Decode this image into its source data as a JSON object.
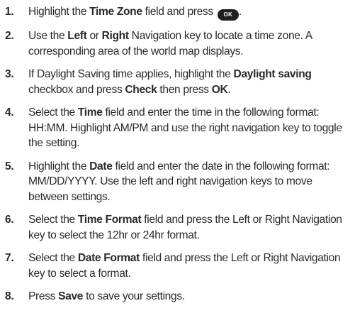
{
  "steps": [
    {
      "number": "1.",
      "parts": [
        {
          "t": "Highlight the "
        },
        {
          "t": "Time Zone",
          "b": true
        },
        {
          "t": " field and press "
        },
        {
          "key": "OK"
        },
        {
          "t": "."
        }
      ]
    },
    {
      "number": "2.",
      "parts": [
        {
          "t": "Use the "
        },
        {
          "t": "Left",
          "b": true
        },
        {
          "t": " or "
        },
        {
          "t": "Right",
          "b": true
        },
        {
          "t": " Navigation key to locate a time zone. A corresponding area of the world map displays."
        }
      ]
    },
    {
      "number": "3.",
      "parts": [
        {
          "t": "If Daylight Saving time applies, highlight the "
        },
        {
          "t": "Daylight saving",
          "b": true
        },
        {
          "t": " checkbox and press "
        },
        {
          "t": "Check",
          "b": true
        },
        {
          "t": " then press "
        },
        {
          "t": "OK",
          "b": true
        },
        {
          "t": "."
        }
      ]
    },
    {
      "number": "4.",
      "parts": [
        {
          "t": "Select the "
        },
        {
          "t": "Time",
          "b": true
        },
        {
          "t": " field and enter the time in the following format: HH:MM. Highlight AM/PM and use the right navigation key to toggle the setting."
        }
      ]
    },
    {
      "number": "5.",
      "parts": [
        {
          "t": "Highlight the "
        },
        {
          "t": "Date",
          "b": true
        },
        {
          "t": " field and enter the date in the following format: MM/DD/YYYY. Use the left and right navigation keys to move between settings."
        }
      ]
    },
    {
      "number": "6.",
      "parts": [
        {
          "t": "Select the "
        },
        {
          "t": "Time Format",
          "b": true
        },
        {
          "t": " field and press the Left or Right Navigation key to select the 12hr or 24hr format."
        }
      ]
    },
    {
      "number": "7.",
      "parts": [
        {
          "t": "Select the "
        },
        {
          "t": "Date Format",
          "b": true
        },
        {
          "t": " field and press the Left or Right Navigation key to select a format."
        }
      ]
    },
    {
      "number": "8.",
      "parts": [
        {
          "t": "Press "
        },
        {
          "t": "Save",
          "b": true
        },
        {
          "t": " to save your settings."
        }
      ]
    }
  ]
}
